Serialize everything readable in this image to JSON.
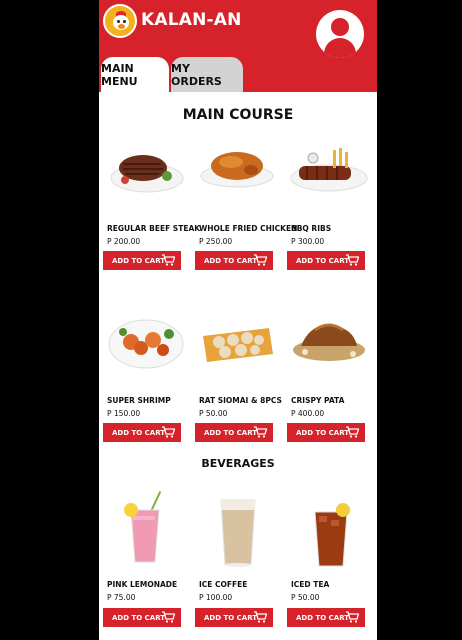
{
  "app": {
    "name": "KALAN-AN"
  },
  "tabs": [
    {
      "label": "MAIN MENU",
      "active": true
    },
    {
      "label": "MY ORDERS",
      "active": false
    }
  ],
  "sections": {
    "main_course": {
      "title": "MAIN COURSE",
      "items": [
        {
          "name": "REGULAR BEEF STEAK",
          "price": "P 200.00",
          "button": "ADD TO CART"
        },
        {
          "name": "WHOLE FRIED CHICKEN",
          "price": "P 250.00",
          "button": "ADD TO CART"
        },
        {
          "name": "BBQ RIBS",
          "price": "P 300.00",
          "button": "ADD TO CART"
        },
        {
          "name": "SUPER SHRIMP",
          "price": "P 150.00",
          "button": "ADD TO CART"
        },
        {
          "name": "RAT SIOMAI & 8PCS",
          "price": "P 50.00",
          "button": "ADD TO CART"
        },
        {
          "name": "CRISPY PATA",
          "price": "P 400.00",
          "button": "ADD TO CART"
        }
      ]
    },
    "beverages": {
      "title": "BEVERAGES",
      "items": [
        {
          "name": "PINK LEMONADE",
          "price": "P 75.00",
          "button": "ADD TO CART"
        },
        {
          "name": "ICE COFFEE",
          "price": "P 100.00",
          "button": "ADD TO CART"
        },
        {
          "name": "ICED TEA",
          "price": "P 50.00",
          "button": "ADD TO CART"
        }
      ]
    }
  },
  "colors": {
    "brand_red": "#d6222a",
    "logo_yellow": "#f3b21c",
    "tab_inactive": "#d3d3d3"
  },
  "icons": [
    "chicken-logo-icon",
    "user-profile-icon",
    "cart-icon"
  ]
}
